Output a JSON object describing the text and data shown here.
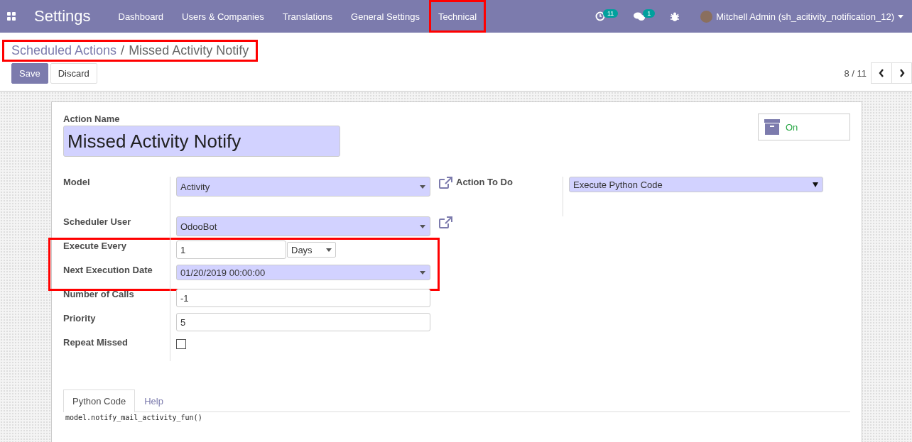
{
  "navbar": {
    "app_title": "Settings",
    "menu": [
      {
        "label": "Dashboard",
        "highlighted": false
      },
      {
        "label": "Users & Companies",
        "highlighted": false
      },
      {
        "label": "Translations",
        "highlighted": false
      },
      {
        "label": "General Settings",
        "highlighted": false
      },
      {
        "label": "Technical",
        "highlighted": true
      }
    ],
    "systray": [
      {
        "kind": "activity",
        "badge": "11"
      },
      {
        "kind": "chat",
        "badge": "1"
      },
      {
        "kind": "debug"
      }
    ],
    "user": "Mitchell Admin (sh_acitivity_notification_12)"
  },
  "breadcrumb": {
    "highlighted": true,
    "separator": "/",
    "items": [
      "Scheduled Actions",
      "Missed Activity Notify"
    ]
  },
  "buttons": [
    {
      "label": "Save",
      "kind": "primary"
    },
    {
      "label": "Discard",
      "kind": "secondary"
    }
  ],
  "pager": "8 / 11",
  "form": {
    "action_name_label": "Action Name",
    "action_name": "Missed Activity Notify",
    "status": {
      "label": "On",
      "active": true
    },
    "model": {
      "label": "Model",
      "value": "Activity"
    },
    "action_to_do": {
      "label": "Action To Do",
      "value": "Execute Python Code"
    },
    "fields": [
      {
        "kind": "many2one",
        "label": "Scheduler User",
        "value": "OdooBot",
        "highlighted": false
      },
      {
        "kind": "interval",
        "label": "Execute Every",
        "value": "1",
        "unit": "Days",
        "highlighted": true
      },
      {
        "kind": "datetime",
        "label": "Next Execution Date",
        "value": "01/20/2019 00:00:00",
        "highlighted": true
      },
      {
        "kind": "text",
        "label": "Number of Calls",
        "value": "-1",
        "highlighted": false
      },
      {
        "kind": "text",
        "label": "Priority",
        "value": "5",
        "highlighted": false
      },
      {
        "kind": "checkbox",
        "label": "Repeat Missed",
        "checked": false,
        "highlighted": false
      }
    ],
    "tabs": [
      {
        "label": "Python Code",
        "selected": true
      },
      {
        "label": "Help",
        "selected": false
      }
    ],
    "code": "model.notify_mail_activity_fun()"
  }
}
